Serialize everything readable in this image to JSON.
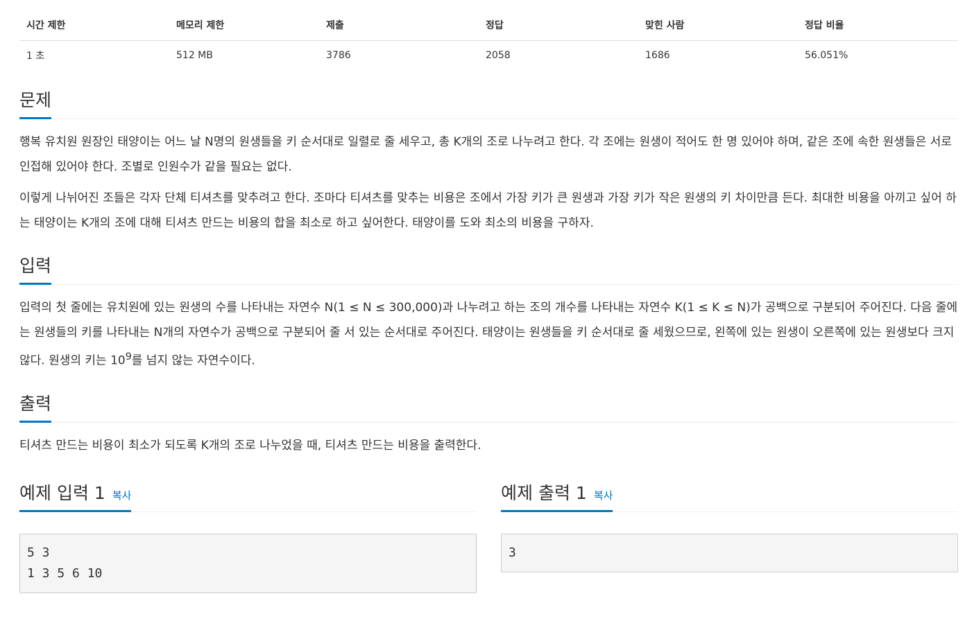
{
  "info_table": {
    "headers": [
      "시간 제한",
      "메모리 제한",
      "제출",
      "정답",
      "맞힌 사람",
      "정답 비율"
    ],
    "values": [
      "1 초",
      "512 MB",
      "3786",
      "2058",
      "1686",
      "56.051%"
    ]
  },
  "problem": {
    "title": "문제",
    "paragraphs": [
      "행복 유치원 원장인 태양이는 어느 날 N명의 원생들을 키 순서대로 일렬로 줄 세우고, 총 K개의 조로 나누려고 한다. 각 조에는 원생이 적어도 한 명 있어야 하며, 같은 조에 속한 원생들은 서로 인접해 있어야 한다. 조별로 인원수가 같을 필요는 없다.",
      "이렇게 나뉘어진 조들은 각자 단체 티셔츠를 맞추려고 한다. 조마다 티셔츠를 맞추는 비용은 조에서 가장 키가 큰 원생과 가장 키가 작은 원생의 키 차이만큼 든다. 최대한 비용을 아끼고 싶어 하는 태양이는 K개의 조에 대해 티셔츠 만드는 비용의 합을 최소로 하고 싶어한다. 태양이를 도와 최소의 비용을 구하자."
    ]
  },
  "input": {
    "title": "입력",
    "text_before_sup": "입력의 첫 줄에는 유치원에 있는 원생의 수를 나타내는 자연수 N(1 ≤ N ≤ 300,000)과 나누려고 하는 조의 개수를 나타내는 자연수 K(1 ≤ K ≤ N)가 공백으로 구분되어 주어진다. 다음 줄에는 원생들의 키를 나타내는 N개의 자연수가 공백으로 구분되어 줄 서 있는 순서대로 주어진다. 태양이는 원생들을 키 순서대로 줄 세웠으므로, 왼쪽에 있는 원생이 오른쪽에 있는 원생보다 크지 않다. 원생의 키는 10",
    "sup": "9",
    "text_after_sup": "를 넘지 않는 자연수이다."
  },
  "output": {
    "title": "출력",
    "text": "티셔츠 만드는 비용이 최소가 되도록 K개의 조로 나누었을 때, 티셔츠 만드는 비용을 출력한다."
  },
  "samples": {
    "copy_label": "복사",
    "input": {
      "title": "예제 입력 1",
      "content": "5 3\n1 3 5 6 10"
    },
    "output": {
      "title": "예제 출력 1",
      "content": "3"
    }
  },
  "colors": {
    "accent": "#0076c0",
    "code_bg": "#f5f5f5",
    "text": "#333333"
  }
}
